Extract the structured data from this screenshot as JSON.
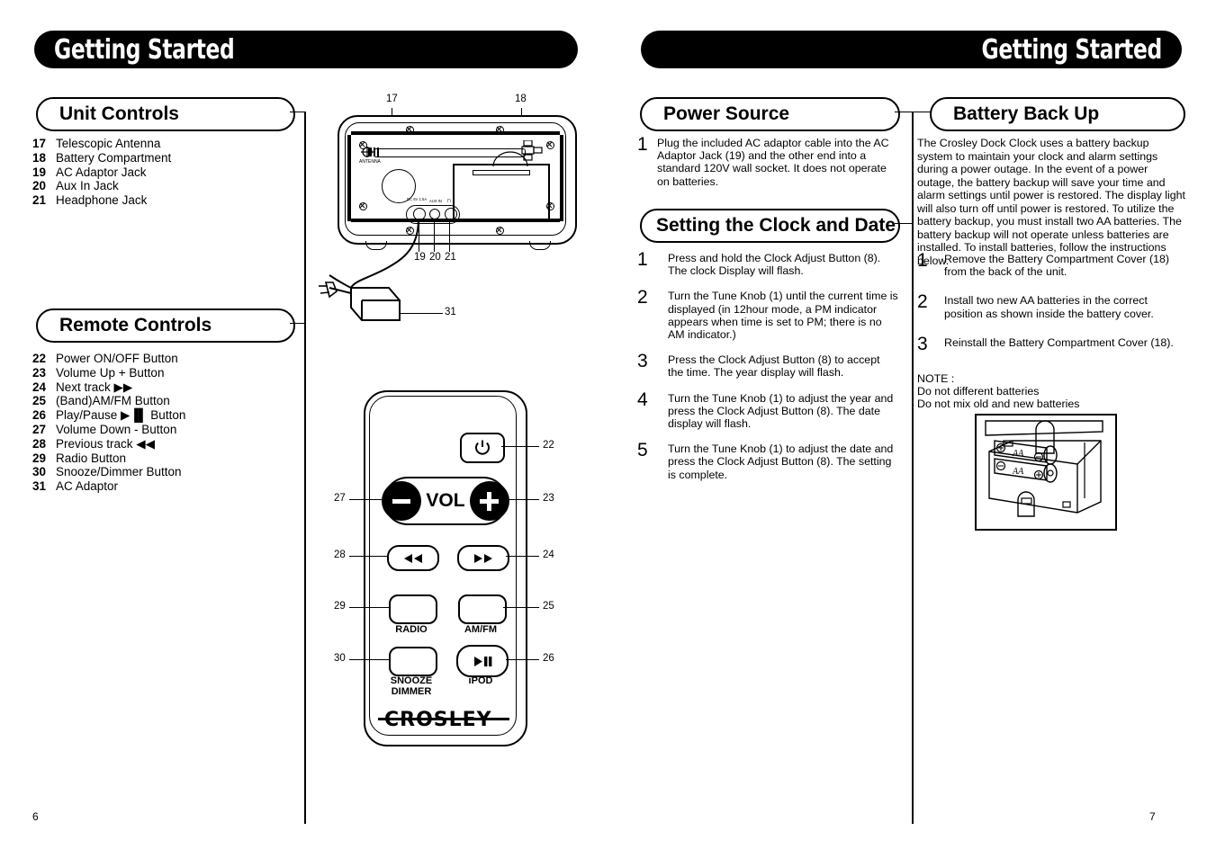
{
  "document": {
    "header_title": "Getting Started",
    "brand": "CROSLEY"
  },
  "left_page": {
    "page_number": "6",
    "sections": [
      {
        "heading": "Unit Controls",
        "items": [
          {
            "num": "17",
            "label": "Telescopic Antenna"
          },
          {
            "num": "18",
            "label": "Battery Compartment"
          },
          {
            "num": "19",
            "label": "AC Adaptor Jack"
          },
          {
            "num": "20",
            "label": "Aux In Jack"
          },
          {
            "num": "21",
            "label": "Headphone Jack"
          }
        ]
      },
      {
        "heading": "Remote Controls",
        "items": [
          {
            "num": "22",
            "label": "Power ON/OFF Button"
          },
          {
            "num": "23",
            "label": "Volume Up + Button"
          },
          {
            "num": "24",
            "label": "Next track ▶▶"
          },
          {
            "num": "25",
            "label": "(Band)AM/FM Button"
          },
          {
            "num": "26",
            "label": "Play/Pause ▶▐▌ Button"
          },
          {
            "num": "27",
            "label": "Volume Down - Button"
          },
          {
            "num": "28",
            "label": "Previous track ◀◀"
          },
          {
            "num": "29",
            "label": "Radio Button"
          },
          {
            "num": "30",
            "label": "Snooze/Dimmer Button"
          },
          {
            "num": "31",
            "label": "AC Adaptor"
          }
        ]
      }
    ],
    "unit_diagram": {
      "callouts": [
        "17",
        "18",
        "19",
        "20",
        "21",
        "31"
      ],
      "panel_labels": {
        "antenna": "ANTENNA",
        "dc_jack": "DC 6V 1.5A",
        "aux_in": "AUX IN",
        "headphone": "∩"
      }
    },
    "remote_diagram": {
      "callouts": [
        "22",
        "23",
        "24",
        "25",
        "26",
        "27",
        "28",
        "29",
        "30"
      ],
      "vol_label": "VOL",
      "button_labels": {
        "radio": "RADIO",
        "amfm": "AM/FM",
        "snooze": "SNOOZE\nDIMMER",
        "snooze_line1": "SNOOZE",
        "snooze_line2": "DIMMER",
        "ipod": "iPOD"
      },
      "logo": "CROSLEY"
    }
  },
  "right_page": {
    "page_number": "7",
    "power_source": {
      "heading": "Power Source",
      "steps": [
        {
          "num": "1",
          "text": "Plug the included AC adaptor cable into the AC Adaptor Jack (19) and the other end into a standard 120V wall socket. It does not operate on batteries."
        }
      ]
    },
    "setting_clock": {
      "heading": "Setting the Clock and Date",
      "steps": [
        {
          "num": "1",
          "text": "Press and hold the Clock Adjust Button (8). The clock Display will flash."
        },
        {
          "num": "2",
          "text": "Turn the Tune Knob (1) until the current time is displayed (in 12hour mode, a PM indicator appears when time is set to PM; there is no AM indicator.)"
        },
        {
          "num": "3",
          "text": "Press the Clock Adjust Button (8) to accept the time. The year display will flash."
        },
        {
          "num": "4",
          "text": "Turn the Tune Knob (1) to adjust the year and press the Clock Adjust Button (8). The date display will flash."
        },
        {
          "num": "5",
          "text": "Turn the Tune Knob (1) to adjust the date and press the Clock Adjust Button (8). The setting is complete."
        }
      ]
    },
    "battery_backup": {
      "heading": "Battery Back Up",
      "intro": "The Crosley Dock Clock uses a battery backup system to maintain your clock and alarm settings during a power outage. In the event of a power outage, the battery backup will save your time and alarm settings until power is restored. The display light will also turn off until power is restored. To utilize the battery backup, you must install two AA batteries. The battery backup will not operate unless batteries are installed. To install batteries, follow the instructions below.",
      "steps": [
        {
          "num": "1",
          "text": "Remove the Battery Compartment Cover (18) from the back of the unit."
        },
        {
          "num": "2",
          "text": "Install two new AA batteries in the correct position as shown inside the battery cover."
        },
        {
          "num": "3",
          "text": "Reinstall the Battery Compartment Cover (18)."
        }
      ],
      "note_title": "NOTE :",
      "note_lines": [
        "Do not different batteries",
        "Do not mix old and new batteries"
      ],
      "battery_image_labels": [
        "AA",
        "AA"
      ]
    }
  }
}
